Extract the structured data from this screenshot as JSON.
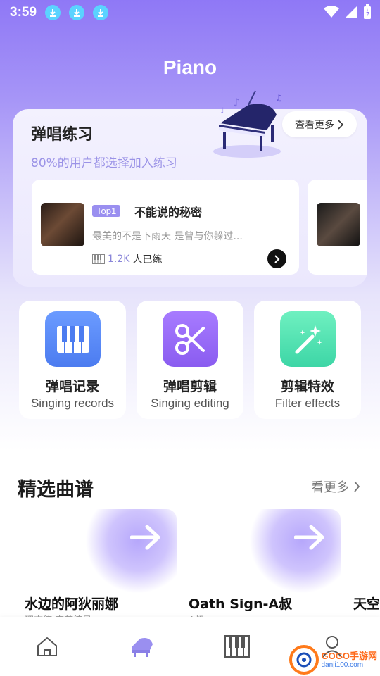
{
  "status": {
    "time": "3:59"
  },
  "header": {
    "title": "Piano"
  },
  "practice": {
    "title": "弹唱练习",
    "subtitle": "80%的用户都选择加入练习",
    "more_label": "查看更多",
    "featured": {
      "badge": "Top1",
      "name": "不能说的秘密",
      "desc": "最美的不是下雨天 是曾与你躲过...",
      "count": "1.2K",
      "count_suffix": "人已练"
    }
  },
  "features": [
    {
      "cn": "弹唱记录",
      "en": "Singing records",
      "icon": "piano-keys-icon",
      "color": "#5b8cff"
    },
    {
      "cn": "弹唱剪辑",
      "en": "Singing editing",
      "icon": "scissors-icon",
      "color": "#9a6bff"
    },
    {
      "cn": "剪辑特效",
      "en": "Filter effects",
      "icon": "magic-wand-icon",
      "color": "#4fe0b0"
    }
  ],
  "scores": {
    "title": "精选曲谱",
    "more_label": "看更多",
    "items": [
      {
        "name": "水边的阿狄丽娜",
        "sub": "理查德·克莱德曼"
      },
      {
        "name": "Oath Sign-A叔",
        "sub": "A叔"
      },
      {
        "name": "天空",
        "sub": ""
      }
    ]
  },
  "tabbar": {
    "tabs": [
      "home-icon",
      "grand-piano-icon",
      "piano-keys-icon",
      "profile-icon"
    ]
  },
  "watermark": {
    "brand": "GOGO手游网",
    "url": "danji100.com"
  },
  "colors": {
    "accent": "#8f78f6",
    "badge": "#9a8ff0"
  }
}
